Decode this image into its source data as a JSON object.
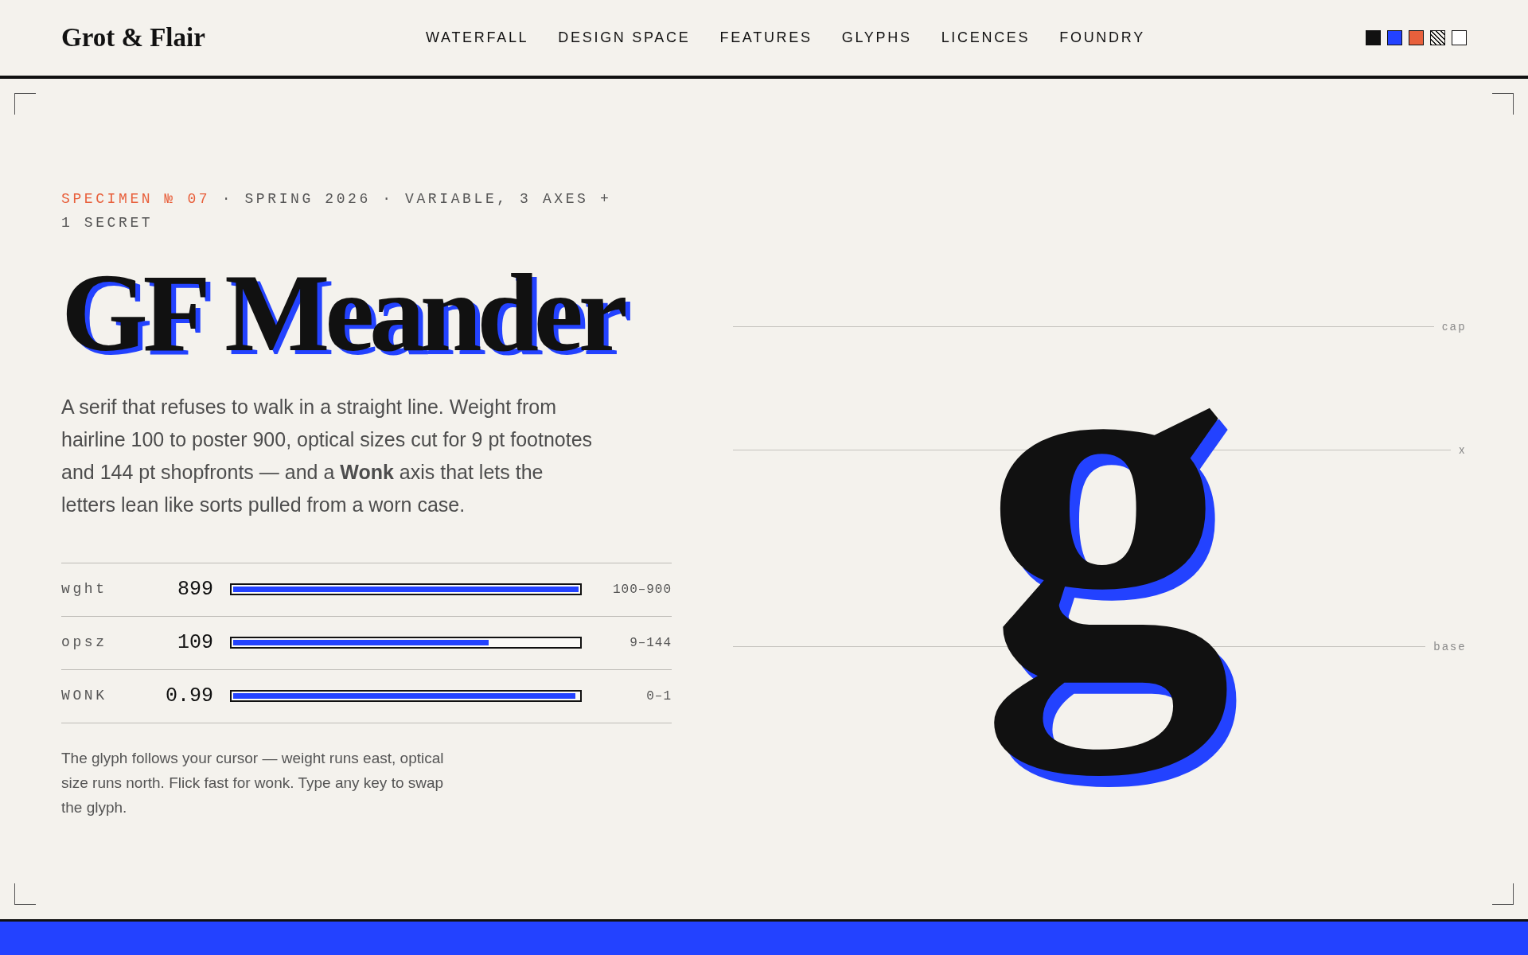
{
  "header": {
    "logo": "Grot & Flair",
    "nav": [
      "WATERFALL",
      "DESIGN SPACE",
      "FEATURES",
      "GLYPHS",
      "LICENCES",
      "FOUNDRY"
    ],
    "swatches": [
      {
        "kind": "solid",
        "color": "#111111"
      },
      {
        "kind": "solid",
        "color": "#2342ff"
      },
      {
        "kind": "solid",
        "color": "#e8603c"
      },
      {
        "kind": "hatched"
      },
      {
        "kind": "solid",
        "color": "#ffffff"
      }
    ]
  },
  "hero": {
    "eyebrow": {
      "highlight": "SPECIMEN № 07",
      "details": "· SPRING 2026 · VARIABLE, 3 AXES + 1 SECRET"
    },
    "title": "GF Meander",
    "description": "A serif that refuses to walk in a straight line. Weight from hairline 100 to poster 900, optical sizes cut for 9 pt footnotes and 144 pt shopfronts — and a **Wonk** axis that lets the letters lean like sorts pulled from a worn case.",
    "axes": [
      {
        "tag": "wght",
        "value": "899",
        "level": 0.999,
        "range": "100–900"
      },
      {
        "tag": "opsz",
        "value": "109",
        "level": 0.74,
        "range": "9–144"
      },
      {
        "tag": "WONK",
        "value": "0.99",
        "level": 0.99,
        "range": "0–1"
      }
    ],
    "note": "The glyph follows your cursor — weight runs east, optical size runs north. Flick fast for wonk. Type any key to swap the glyph."
  },
  "specimen": {
    "guides": [
      {
        "kind": "cap",
        "label": "cap"
      },
      {
        "kind": "x-height",
        "label": "x"
      },
      {
        "kind": "baseline",
        "label": "base"
      }
    ],
    "glyph": "g"
  }
}
